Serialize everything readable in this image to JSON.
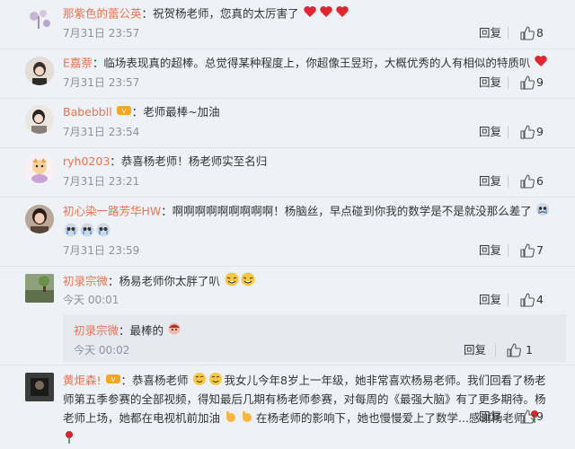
{
  "comments": [
    {
      "name": "那紫色的蕾公英",
      "content": "祝贺杨老师，您真的太厉害了",
      "time": "7月31日 23:57",
      "reply": "回复",
      "likes": "8"
    },
    {
      "name": "E嘉萘",
      "content": "临场表现真的超棒。总觉得某种程度上，你超像王昱珩，大概优秀的人有相似的特质叭",
      "time": "7月31日 23:57",
      "reply": "回复",
      "likes": "9"
    },
    {
      "name": "Babebbll",
      "content": "老师最棒~加油",
      "time": "7月31日 23:54",
      "reply": "回复",
      "likes": "9"
    },
    {
      "name": "ryh0203",
      "content": "恭喜杨老师！杨老师实至名归",
      "time": "7月31日 23:21",
      "reply": "回复",
      "likes": "6"
    },
    {
      "name": "初心染一路芳华HW",
      "content": "啊啊啊啊啊啊啊啊啊！杨脑丝，早点碰到你我的数学是不是就没那么差了",
      "time": "7月31日 23:59",
      "reply": "回复",
      "likes": "7"
    },
    {
      "name": "初录宗微",
      "content": "杨易老师你太胖了叭",
      "time": "今天 00:01",
      "reply": "回复",
      "likes": "4"
    },
    {
      "name": "黄炬森!",
      "content1": "恭喜杨老师",
      "content2": "我女儿今年8岁上一年级，她非常喜欢杨易老师。我们回看了杨老",
      "content3": "师第五季参赛的全部视频，得知最后几期有杨老师参赛，对每周的《最强大脑》有了更多期待。杨",
      "content4": "老师上场，她都在电视机前加油",
      "content5": "在杨老师的影响下，她也慢慢爱上了数学...感谢杨老师",
      "reply": "回复",
      "likes": "9"
    }
  ],
  "sub_reply": {
    "name": "初录宗微",
    "content": "最棒的",
    "time": "今天 00:02",
    "reply": "回复",
    "likes": "1"
  },
  "colors": {
    "name": "#eb7350",
    "background": "#eef1f6",
    "subbox": "#e6e9ef"
  }
}
